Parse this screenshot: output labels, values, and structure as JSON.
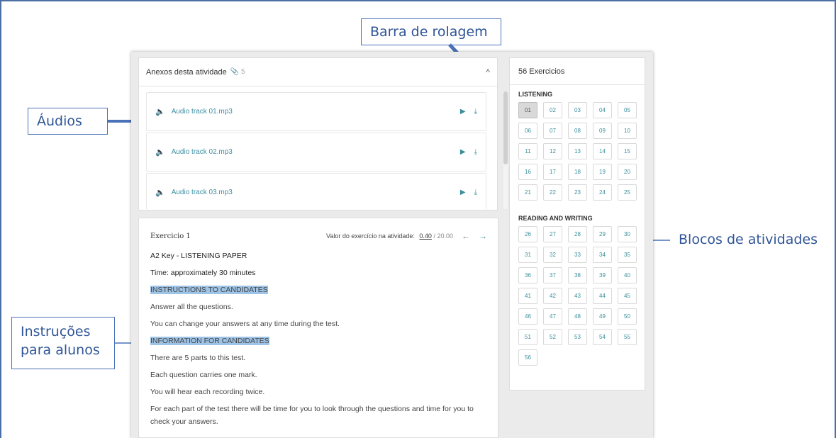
{
  "callouts": {
    "audios": "Áudios",
    "barra": "Barra de rolagem",
    "blocos": "Blocos de atividades",
    "instrucoes_line1": "Instruções",
    "instrucoes_line2": "para alunos"
  },
  "attachments": {
    "title": "Anexos desta atividade",
    "count": "5",
    "tracks": [
      {
        "name": "Audio track 01.mp3"
      },
      {
        "name": "Audio track 02.mp3"
      },
      {
        "name": "Audio track 03.mp3"
      }
    ]
  },
  "exercise": {
    "title": "Exercicio 1",
    "value_label": "Valor do exercício na atividade:",
    "score": "0.40",
    "total": "20.00",
    "lines": [
      "A2 Key - LISTENING PAPER",
      "Time: approximately 30 minutes",
      "INSTRUCTIONS TO CANDIDATES",
      "Answer all the questions.",
      "You can change your answers at any time during the test.",
      "INFORMATION FOR CANDIDATES",
      "There are 5 parts to this test.",
      "Each question carries one mark.",
      "You will hear each recording twice.",
      "For each part of the test there will be time for you to look through the questions and time for you to check your answers."
    ]
  },
  "exercises_panel": {
    "title": "56 Exercicios",
    "listening_label": "LISTENING",
    "listening": [
      "01",
      "02",
      "03",
      "04",
      "05",
      "06",
      "07",
      "08",
      "09",
      "10",
      "11",
      "12",
      "13",
      "14",
      "15",
      "16",
      "17",
      "18",
      "19",
      "20",
      "21",
      "22",
      "23",
      "24",
      "25"
    ],
    "reading_label": "READING AND WRITING",
    "reading": [
      "26",
      "27",
      "28",
      "29",
      "30",
      "31",
      "32",
      "33",
      "34",
      "35",
      "36",
      "37",
      "38",
      "39",
      "40",
      "41",
      "42",
      "43",
      "44",
      "45",
      "46",
      "47",
      "48",
      "49",
      "50",
      "51",
      "52",
      "53",
      "54",
      "55",
      "56"
    ],
    "active": "01"
  },
  "colors": {
    "callout_border": "#4a72b8",
    "callout_text": "#2f5597",
    "accent": "#3a8e9c",
    "speaker": "#9b30b8",
    "highlight": "#9dc3e6"
  }
}
